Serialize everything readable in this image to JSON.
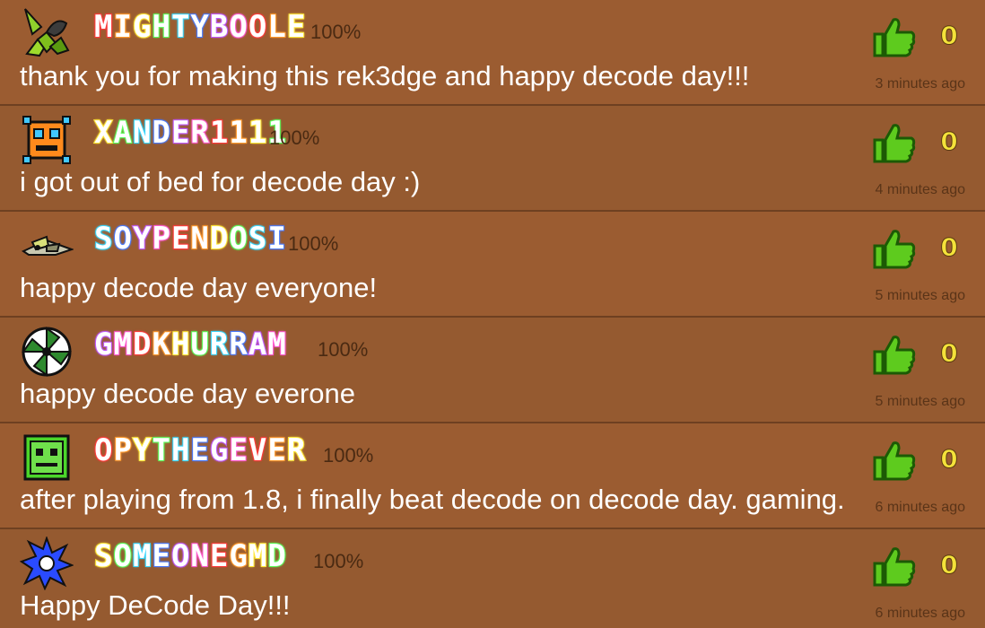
{
  "comments": [
    {
      "username": "MIGHTYBOOLE",
      "percent": "100%",
      "message": "thank you for making this rek3dge and happy decode day!!!",
      "likes": "0",
      "time": "3 minutes ago",
      "icon": "spider-icon"
    },
    {
      "username": "XANDER1111",
      "percent": "100%",
      "message": "i got out of bed for decode day :)",
      "likes": "0",
      "time": "4 minutes ago",
      "icon": "orange-robot-cube-icon"
    },
    {
      "username": "SOYPENDOSI",
      "percent": "100%",
      "message": "happy decode day everyone!",
      "likes": "0",
      "time": "5 minutes ago",
      "icon": "ship-icon"
    },
    {
      "username": "GMDKHURRAM",
      "percent": "100%",
      "message": "happy decode day everone",
      "likes": "0",
      "time": "5 minutes ago",
      "icon": "pinwheel-icon"
    },
    {
      "username": "OPYTHEGEVER",
      "percent": "100%",
      "message": "after playing from 1.8, i finally beat decode on decode day. gaming.",
      "likes": "0",
      "time": "6 minutes ago",
      "icon": "green-cube-icon"
    },
    {
      "username": "SOMEONEGMD",
      "percent": "100%",
      "message": "Happy DeCode Day!!!",
      "likes": "0",
      "time": "6 minutes ago",
      "icon": "blue-sawblade-icon"
    }
  ],
  "colors": {
    "background": "#955a30",
    "like_green": "#5ecb1e",
    "like_count_yellow": "#f4e23a",
    "rainbow": [
      "#ff3b3b",
      "#ff9a2e",
      "#ffe83a",
      "#5dff5d",
      "#3bd8ff",
      "#4a7bff",
      "#c05bff",
      "#ff5bd0"
    ]
  }
}
